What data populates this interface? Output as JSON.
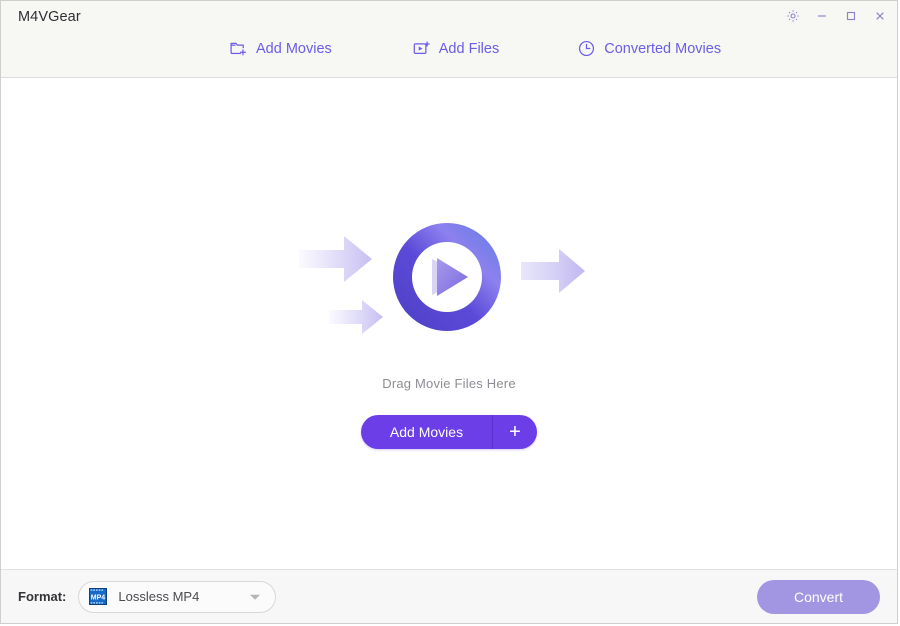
{
  "window": {
    "title": "M4VGear",
    "controls": [
      {
        "name": "settings-button",
        "icon": "gear-icon",
        "label": "Settings"
      },
      {
        "name": "minimize-button",
        "icon": "minimize-icon",
        "label": "Minimize"
      },
      {
        "name": "maximize-button",
        "icon": "maximize-icon",
        "label": "Maximize"
      },
      {
        "name": "close-button",
        "icon": "close-icon",
        "label": "Close"
      }
    ]
  },
  "toolbar": {
    "items": [
      {
        "label": "Add Movies",
        "icon": "folder-plus-icon"
      },
      {
        "label": "Add Files",
        "icon": "video-plus-icon"
      },
      {
        "label": "Converted Movies",
        "icon": "clock-icon"
      }
    ]
  },
  "main": {
    "hero_icon": "play-circle-convert-illustration",
    "drag_text": "Drag Movie Files Here",
    "add_movies_button": {
      "label": "Add Movies",
      "plus": "+"
    }
  },
  "footer": {
    "format_label": "Format:",
    "format_value": "Lossless MP4",
    "format_icon": "mp4-film-icon",
    "convert_label": "Convert"
  },
  "colors": {
    "accent": "#6c5ce7",
    "button_primary": "#6c3ee8",
    "button_disabled": "#a296e2",
    "header_bg": "#f7f7f4",
    "footer_bg": "#f7f7f7",
    "text_muted": "#8d8d93"
  }
}
